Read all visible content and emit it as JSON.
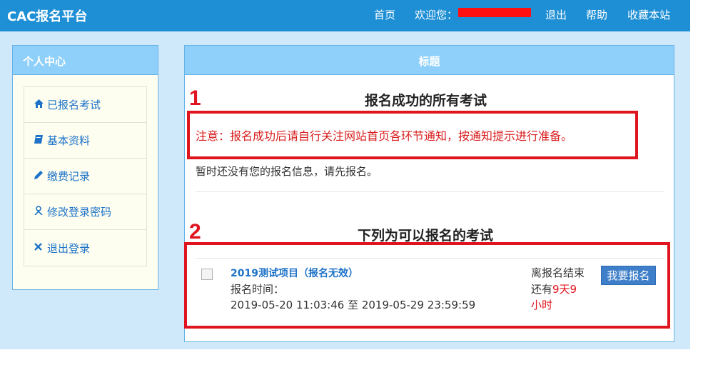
{
  "header": {
    "brand": "CAC报名平台",
    "nav": {
      "home": "首页",
      "welcome": "欢迎您：",
      "logout": "退出",
      "help": "帮助",
      "bookmark": "收藏本站"
    }
  },
  "sidebar": {
    "title": "个人中心",
    "items": [
      {
        "label": "已报名考试",
        "icon": "home-icon"
      },
      {
        "label": "基本资料",
        "icon": "book-icon"
      },
      {
        "label": "缴费记录",
        "icon": "pencil-icon"
      },
      {
        "label": "修改登录密码",
        "icon": "user-icon"
      },
      {
        "label": "退出登录",
        "icon": "close-icon"
      }
    ]
  },
  "main": {
    "panel_title": "标题",
    "annotation_1": "1",
    "annotation_2": "2",
    "section1_title": "报名成功的所有考试",
    "notice": "注意：报名成功后请自行关注网站首页各环节通知，按通知提示进行准备。",
    "empty_message": "暂时还没有您的报名信息，请先报名。",
    "section2_title": "下列为可以报名的考试",
    "exam": {
      "name": "2019测试项目（报名无效）",
      "time_label": "报名时间：",
      "time_range": "2019-05-20 11:03:46 至 2019-05-29 23:59:59",
      "countdown_label": "离报名结束",
      "countdown_prefix": "还有",
      "countdown_days": "9天9",
      "countdown_hours": "小时",
      "register_button": "我要报名"
    }
  },
  "colors": {
    "accent": "#1e8fd4",
    "annotation_red": "#e0141e",
    "link": "#1e73c8"
  }
}
